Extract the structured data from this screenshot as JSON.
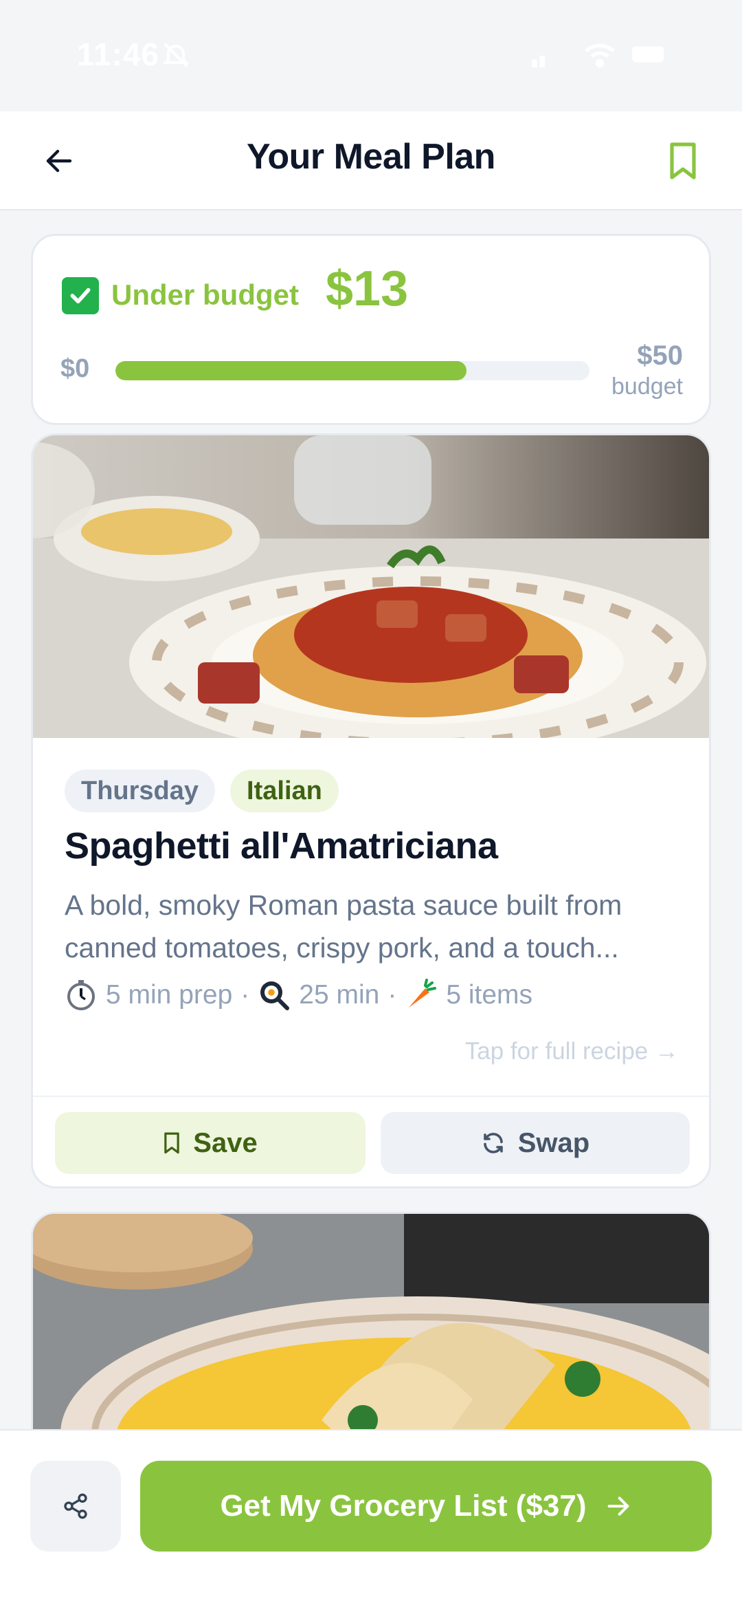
{
  "status_bar": {
    "time": "11:46"
  },
  "header": {
    "title": "Your Meal Plan"
  },
  "budget": {
    "status_label": "Under budget",
    "remaining": "$13",
    "min_label": "$0",
    "max_label": "$50",
    "max_sublabel": "budget",
    "spent_fraction": 0.74
  },
  "meal": {
    "day": "Thursday",
    "cuisine": "Italian",
    "title": "Spaghetti all'Amatriciana",
    "description": "A bold, smoky Roman pasta sauce built from canned tomatoes, crispy pork, and a touch...",
    "prep": "5 min prep",
    "cook": "25 min",
    "items": "5 items",
    "separator": "·",
    "tap_hint": "Tap for full recipe →",
    "save_label": "Save",
    "swap_label": "Swap"
  },
  "bottom": {
    "cta_label": "Get My Grocery List ($37)"
  },
  "colors": {
    "accent": "#8ac43f",
    "text": "#0f172a",
    "muted": "#94a3b8"
  }
}
